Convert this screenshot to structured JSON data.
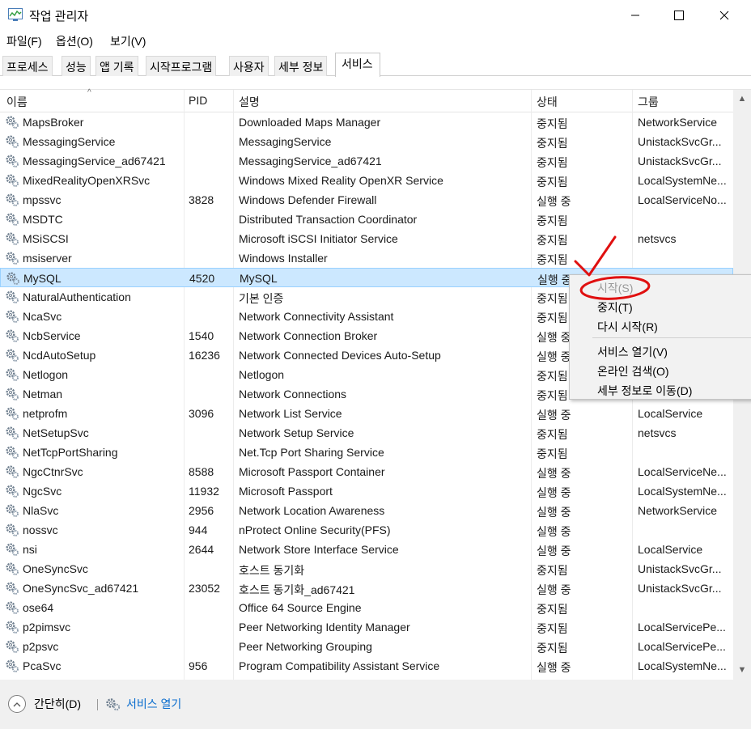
{
  "window": {
    "title": "작업 관리자"
  },
  "menu": [
    "파일(F)",
    "옵션(O)",
    "보기(V)"
  ],
  "tabs": [
    "프로세스",
    "성능",
    "앱 기록",
    "시작프로그램",
    "사용자",
    "세부 정보",
    "서비스"
  ],
  "active_tab": "서비스",
  "columns": {
    "name": "이름",
    "pid": "PID",
    "desc": "설명",
    "status": "상태",
    "group": "그룹"
  },
  "rows": [
    {
      "name": "MapsBroker",
      "pid": "",
      "desc": "Downloaded Maps Manager",
      "status": "중지됨",
      "group": "NetworkService"
    },
    {
      "name": "MessagingService",
      "pid": "",
      "desc": "MessagingService",
      "status": "중지됨",
      "group": "UnistackSvcGr..."
    },
    {
      "name": "MessagingService_ad67421",
      "pid": "",
      "desc": "MessagingService_ad67421",
      "status": "중지됨",
      "group": "UnistackSvcGr..."
    },
    {
      "name": "MixedRealityOpenXRSvc",
      "pid": "",
      "desc": "Windows Mixed Reality OpenXR Service",
      "status": "중지됨",
      "group": "LocalSystemNe..."
    },
    {
      "name": "mpssvc",
      "pid": "3828",
      "desc": "Windows Defender Firewall",
      "status": "실행 중",
      "group": "LocalServiceNo..."
    },
    {
      "name": "MSDTC",
      "pid": "",
      "desc": "Distributed Transaction Coordinator",
      "status": "중지됨",
      "group": ""
    },
    {
      "name": "MSiSCSI",
      "pid": "",
      "desc": "Microsoft iSCSI Initiator Service",
      "status": "중지됨",
      "group": "netsvcs"
    },
    {
      "name": "msiserver",
      "pid": "",
      "desc": "Windows Installer",
      "status": "중지됨",
      "group": ""
    },
    {
      "name": "MySQL",
      "pid": "4520",
      "desc": "MySQL",
      "status": "실행 중",
      "group": ""
    },
    {
      "name": "NaturalAuthentication",
      "pid": "",
      "desc": "기본 인증",
      "status": "중지됨",
      "group": ""
    },
    {
      "name": "NcaSvc",
      "pid": "",
      "desc": "Network Connectivity Assistant",
      "status": "중지됨",
      "group": ""
    },
    {
      "name": "NcbService",
      "pid": "1540",
      "desc": "Network Connection Broker",
      "status": "실행 중",
      "group": ""
    },
    {
      "name": "NcdAutoSetup",
      "pid": "16236",
      "desc": "Network Connected Devices Auto-Setup",
      "status": "실행 중",
      "group": ""
    },
    {
      "name": "Netlogon",
      "pid": "",
      "desc": "Netlogon",
      "status": "중지됨",
      "group": ""
    },
    {
      "name": "Netman",
      "pid": "",
      "desc": "Network Connections",
      "status": "중지됨",
      "group": ""
    },
    {
      "name": "netprofm",
      "pid": "3096",
      "desc": "Network List Service",
      "status": "실행 중",
      "group": "LocalService"
    },
    {
      "name": "NetSetupSvc",
      "pid": "",
      "desc": "Network Setup Service",
      "status": "중지됨",
      "group": "netsvcs"
    },
    {
      "name": "NetTcpPortSharing",
      "pid": "",
      "desc": "Net.Tcp Port Sharing Service",
      "status": "중지됨",
      "group": ""
    },
    {
      "name": "NgcCtnrSvc",
      "pid": "8588",
      "desc": "Microsoft Passport Container",
      "status": "실행 중",
      "group": "LocalServiceNe..."
    },
    {
      "name": "NgcSvc",
      "pid": "11932",
      "desc": "Microsoft Passport",
      "status": "실행 중",
      "group": "LocalSystemNe..."
    },
    {
      "name": "NlaSvc",
      "pid": "2956",
      "desc": "Network Location Awareness",
      "status": "실행 중",
      "group": "NetworkService"
    },
    {
      "name": "nossvc",
      "pid": "944",
      "desc": "nProtect Online Security(PFS)",
      "status": "실행 중",
      "group": ""
    },
    {
      "name": "nsi",
      "pid": "2644",
      "desc": "Network Store Interface Service",
      "status": "실행 중",
      "group": "LocalService"
    },
    {
      "name": "OneSyncSvc",
      "pid": "",
      "desc": "호스트 동기화",
      "status": "중지됨",
      "group": "UnistackSvcGr..."
    },
    {
      "name": "OneSyncSvc_ad67421",
      "pid": "23052",
      "desc": "호스트 동기화_ad67421",
      "status": "실행 중",
      "group": "UnistackSvcGr..."
    },
    {
      "name": "ose64",
      "pid": "",
      "desc": "Office 64 Source Engine",
      "status": "중지됨",
      "group": ""
    },
    {
      "name": "p2pimsvc",
      "pid": "",
      "desc": "Peer Networking Identity Manager",
      "status": "중지됨",
      "group": "LocalServicePe..."
    },
    {
      "name": "p2psvc",
      "pid": "",
      "desc": "Peer Networking Grouping",
      "status": "중지됨",
      "group": "LocalServicePe..."
    },
    {
      "name": "PcaSvc",
      "pid": "956",
      "desc": "Program Compatibility Assistant Service",
      "status": "실행 중",
      "group": "LocalSystemNe..."
    }
  ],
  "selected_row": "MySQL",
  "context_menu": {
    "start": "시작(S)",
    "stop": "중지(T)",
    "restart": "다시 시작(R)",
    "open_services": "서비스 열기(V)",
    "search_online": "온라인 검색(O)",
    "go_to_details": "세부 정보로 이동(D)"
  },
  "footer": {
    "collapse_label": "간단히(D)",
    "open_services_link": "서비스 열기"
  },
  "colors": {
    "selection": "#cce8ff",
    "link": "#0a6dce",
    "annotation": "#e01010"
  }
}
